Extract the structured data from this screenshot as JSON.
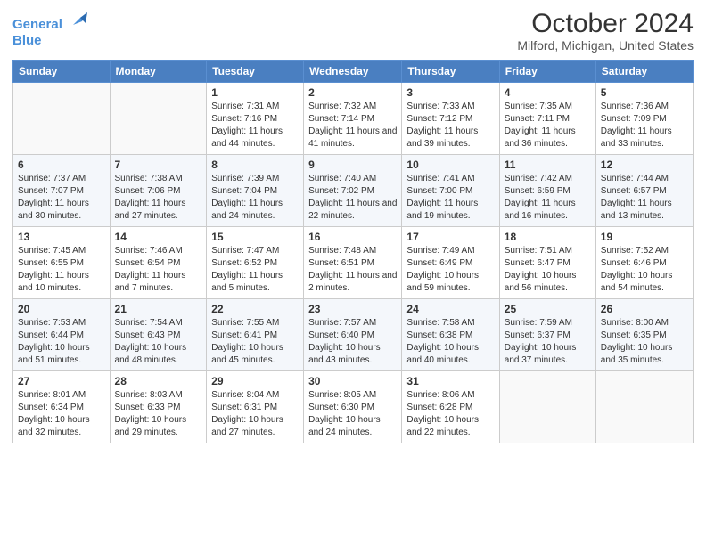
{
  "header": {
    "logo_line1": "General",
    "logo_line2": "Blue",
    "title": "October 2024",
    "subtitle": "Milford, Michigan, United States"
  },
  "days_of_week": [
    "Sunday",
    "Monday",
    "Tuesday",
    "Wednesday",
    "Thursday",
    "Friday",
    "Saturday"
  ],
  "weeks": [
    [
      {
        "day": "",
        "info": ""
      },
      {
        "day": "",
        "info": ""
      },
      {
        "day": "1",
        "info": "Sunrise: 7:31 AM\nSunset: 7:16 PM\nDaylight: 11 hours and 44 minutes."
      },
      {
        "day": "2",
        "info": "Sunrise: 7:32 AM\nSunset: 7:14 PM\nDaylight: 11 hours and 41 minutes."
      },
      {
        "day": "3",
        "info": "Sunrise: 7:33 AM\nSunset: 7:12 PM\nDaylight: 11 hours and 39 minutes."
      },
      {
        "day": "4",
        "info": "Sunrise: 7:35 AM\nSunset: 7:11 PM\nDaylight: 11 hours and 36 minutes."
      },
      {
        "day": "5",
        "info": "Sunrise: 7:36 AM\nSunset: 7:09 PM\nDaylight: 11 hours and 33 minutes."
      }
    ],
    [
      {
        "day": "6",
        "info": "Sunrise: 7:37 AM\nSunset: 7:07 PM\nDaylight: 11 hours and 30 minutes."
      },
      {
        "day": "7",
        "info": "Sunrise: 7:38 AM\nSunset: 7:06 PM\nDaylight: 11 hours and 27 minutes."
      },
      {
        "day": "8",
        "info": "Sunrise: 7:39 AM\nSunset: 7:04 PM\nDaylight: 11 hours and 24 minutes."
      },
      {
        "day": "9",
        "info": "Sunrise: 7:40 AM\nSunset: 7:02 PM\nDaylight: 11 hours and 22 minutes."
      },
      {
        "day": "10",
        "info": "Sunrise: 7:41 AM\nSunset: 7:00 PM\nDaylight: 11 hours and 19 minutes."
      },
      {
        "day": "11",
        "info": "Sunrise: 7:42 AM\nSunset: 6:59 PM\nDaylight: 11 hours and 16 minutes."
      },
      {
        "day": "12",
        "info": "Sunrise: 7:44 AM\nSunset: 6:57 PM\nDaylight: 11 hours and 13 minutes."
      }
    ],
    [
      {
        "day": "13",
        "info": "Sunrise: 7:45 AM\nSunset: 6:55 PM\nDaylight: 11 hours and 10 minutes."
      },
      {
        "day": "14",
        "info": "Sunrise: 7:46 AM\nSunset: 6:54 PM\nDaylight: 11 hours and 7 minutes."
      },
      {
        "day": "15",
        "info": "Sunrise: 7:47 AM\nSunset: 6:52 PM\nDaylight: 11 hours and 5 minutes."
      },
      {
        "day": "16",
        "info": "Sunrise: 7:48 AM\nSunset: 6:51 PM\nDaylight: 11 hours and 2 minutes."
      },
      {
        "day": "17",
        "info": "Sunrise: 7:49 AM\nSunset: 6:49 PM\nDaylight: 10 hours and 59 minutes."
      },
      {
        "day": "18",
        "info": "Sunrise: 7:51 AM\nSunset: 6:47 PM\nDaylight: 10 hours and 56 minutes."
      },
      {
        "day": "19",
        "info": "Sunrise: 7:52 AM\nSunset: 6:46 PM\nDaylight: 10 hours and 54 minutes."
      }
    ],
    [
      {
        "day": "20",
        "info": "Sunrise: 7:53 AM\nSunset: 6:44 PM\nDaylight: 10 hours and 51 minutes."
      },
      {
        "day": "21",
        "info": "Sunrise: 7:54 AM\nSunset: 6:43 PM\nDaylight: 10 hours and 48 minutes."
      },
      {
        "day": "22",
        "info": "Sunrise: 7:55 AM\nSunset: 6:41 PM\nDaylight: 10 hours and 45 minutes."
      },
      {
        "day": "23",
        "info": "Sunrise: 7:57 AM\nSunset: 6:40 PM\nDaylight: 10 hours and 43 minutes."
      },
      {
        "day": "24",
        "info": "Sunrise: 7:58 AM\nSunset: 6:38 PM\nDaylight: 10 hours and 40 minutes."
      },
      {
        "day": "25",
        "info": "Sunrise: 7:59 AM\nSunset: 6:37 PM\nDaylight: 10 hours and 37 minutes."
      },
      {
        "day": "26",
        "info": "Sunrise: 8:00 AM\nSunset: 6:35 PM\nDaylight: 10 hours and 35 minutes."
      }
    ],
    [
      {
        "day": "27",
        "info": "Sunrise: 8:01 AM\nSunset: 6:34 PM\nDaylight: 10 hours and 32 minutes."
      },
      {
        "day": "28",
        "info": "Sunrise: 8:03 AM\nSunset: 6:33 PM\nDaylight: 10 hours and 29 minutes."
      },
      {
        "day": "29",
        "info": "Sunrise: 8:04 AM\nSunset: 6:31 PM\nDaylight: 10 hours and 27 minutes."
      },
      {
        "day": "30",
        "info": "Sunrise: 8:05 AM\nSunset: 6:30 PM\nDaylight: 10 hours and 24 minutes."
      },
      {
        "day": "31",
        "info": "Sunrise: 8:06 AM\nSunset: 6:28 PM\nDaylight: 10 hours and 22 minutes."
      },
      {
        "day": "",
        "info": ""
      },
      {
        "day": "",
        "info": ""
      }
    ]
  ]
}
